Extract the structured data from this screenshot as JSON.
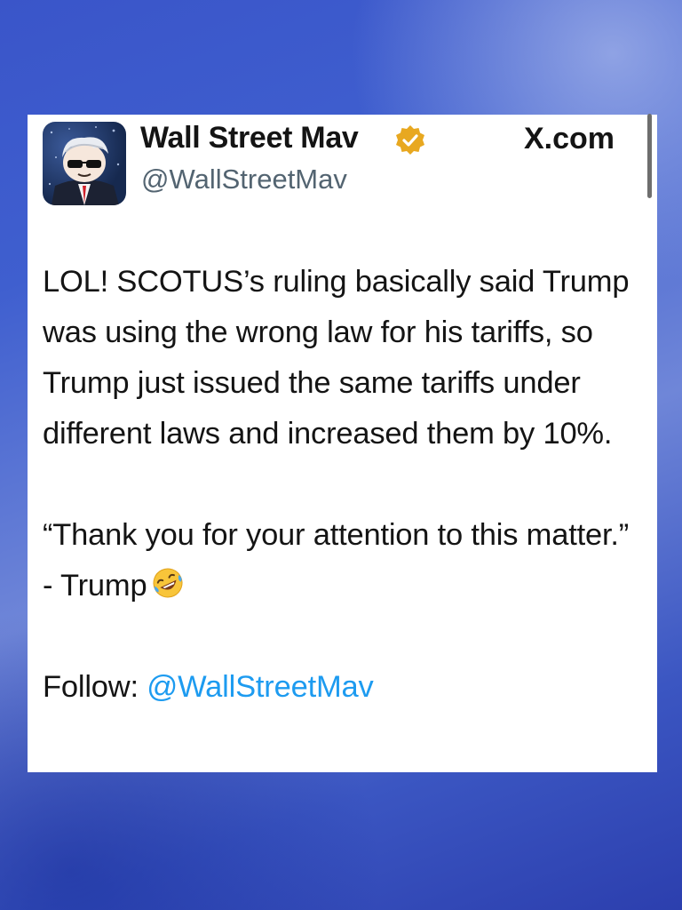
{
  "header": {
    "display_name": "Wall Street Mav",
    "handle": "@WallStreetMav",
    "site": "X.com",
    "verified_icon": "verified-badge-gold"
  },
  "tweet": {
    "paragraph1": "LOL! SCOTUS’s ruling basically said Trump was using the wrong law for his tariffs, so Trump just issued the same tariffs under different laws and increased them by 10%.",
    "paragraph2": "“Thank you for your attention to this matter.” - Trump",
    "paragraph2_emoji": "rolling-on-floor-laughing-emoji",
    "follow_label": "Follow:",
    "follow_handle": "@WallStreetMav"
  },
  "colors": {
    "link": "#1d9bf0",
    "handle": "#536471",
    "verified": "#e8a820"
  }
}
